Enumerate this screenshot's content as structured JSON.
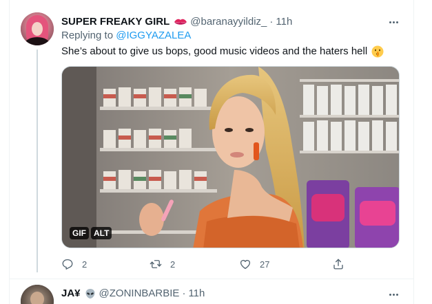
{
  "tweet": {
    "display_name": "SUPER FREAKY GIRL",
    "name_emoji": "lips-icon",
    "handle": "@baranayyildiz_",
    "separator": "·",
    "time": "11h",
    "replying_prefix": "Replying to",
    "replying_to": "@IGGYAZALEA",
    "text": "She’s about to give us bops, good music videos and the haters hell",
    "text_emoji": "shushing-face-emoji",
    "media": {
      "type": "gif",
      "gif_badge": "GIF",
      "alt_badge": "ALT"
    },
    "actions": {
      "reply_count": "2",
      "retweet_count": "2",
      "like_count": "27"
    }
  },
  "next_tweet": {
    "display_name": "JA¥",
    "name_emoji": "alien-icon",
    "handle": "@ZONINBARBIE",
    "separator": "·",
    "time": "11h"
  },
  "colors": {
    "text_primary": "#0f1419",
    "text_secondary": "#536471",
    "link": "#1d9bf0",
    "border": "#cfd9de"
  }
}
